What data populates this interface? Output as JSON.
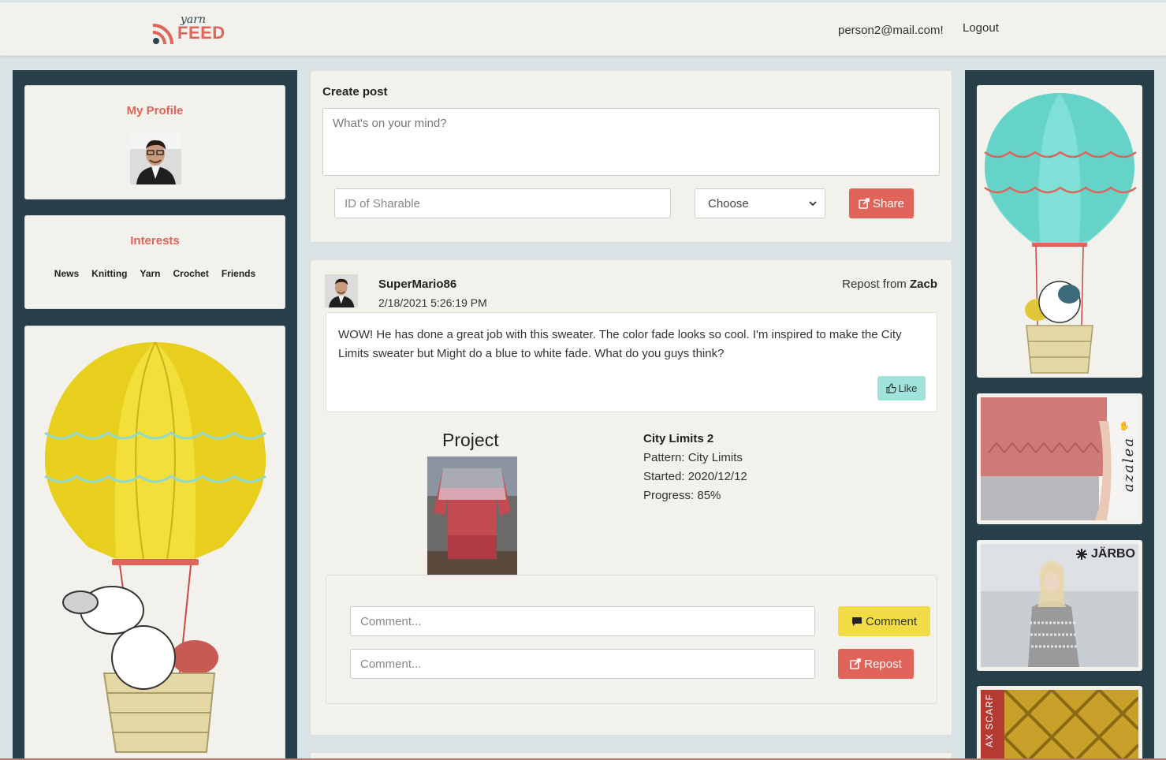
{
  "brand": {
    "top_word": "yarn",
    "bottom_word": "FEED",
    "accent": "#e06459",
    "dark": "#263f49"
  },
  "nav": {
    "user_email": "person2@mail.com!",
    "logout_label": "Logout"
  },
  "profile": {
    "heading": "My Profile"
  },
  "interests": {
    "heading": "Interests",
    "items": [
      "News",
      "Knitting",
      "Yarn",
      "Crochet",
      "Friends"
    ]
  },
  "create_post": {
    "title": "Create post",
    "textarea_placeholder": "What's on your mind?",
    "sharable_placeholder": "ID of Sharable",
    "select_value": "Choose",
    "share_label": "Share"
  },
  "post": {
    "author": "SuperMario86",
    "timestamp": "2/18/2021 5:26:19 PM",
    "repost_prefix": "Repost from",
    "repost_user": "Zacb",
    "text": "WOW! He has done a great job with this sweater. The color fade looks so cool. I'm inspired to make the City Limits sweater but Might do a blue to white fade. What do you guys think?",
    "like_label": "Like",
    "project": {
      "heading": "Project",
      "name": "City Limits 2",
      "pattern": "Pattern: City Limits",
      "started": "Started: 2020/12/12",
      "progress": "Progress: 85%"
    },
    "comment_placeholder": "Comment...",
    "repost_placeholder": "Comment...",
    "comment_label": "Comment",
    "repost_label": "Repost"
  },
  "ads": [
    {
      "brand_text": "azalea"
    },
    {
      "brand_text": "JÄRBO"
    },
    {
      "brand_text": "AX SCARF"
    }
  ],
  "colors": {
    "share_red": "#e06459",
    "like_teal": "#9fe3da",
    "comment_yellow": "#f2dc45",
    "background": "#d9e3e6",
    "card": "#f2f1ec"
  }
}
